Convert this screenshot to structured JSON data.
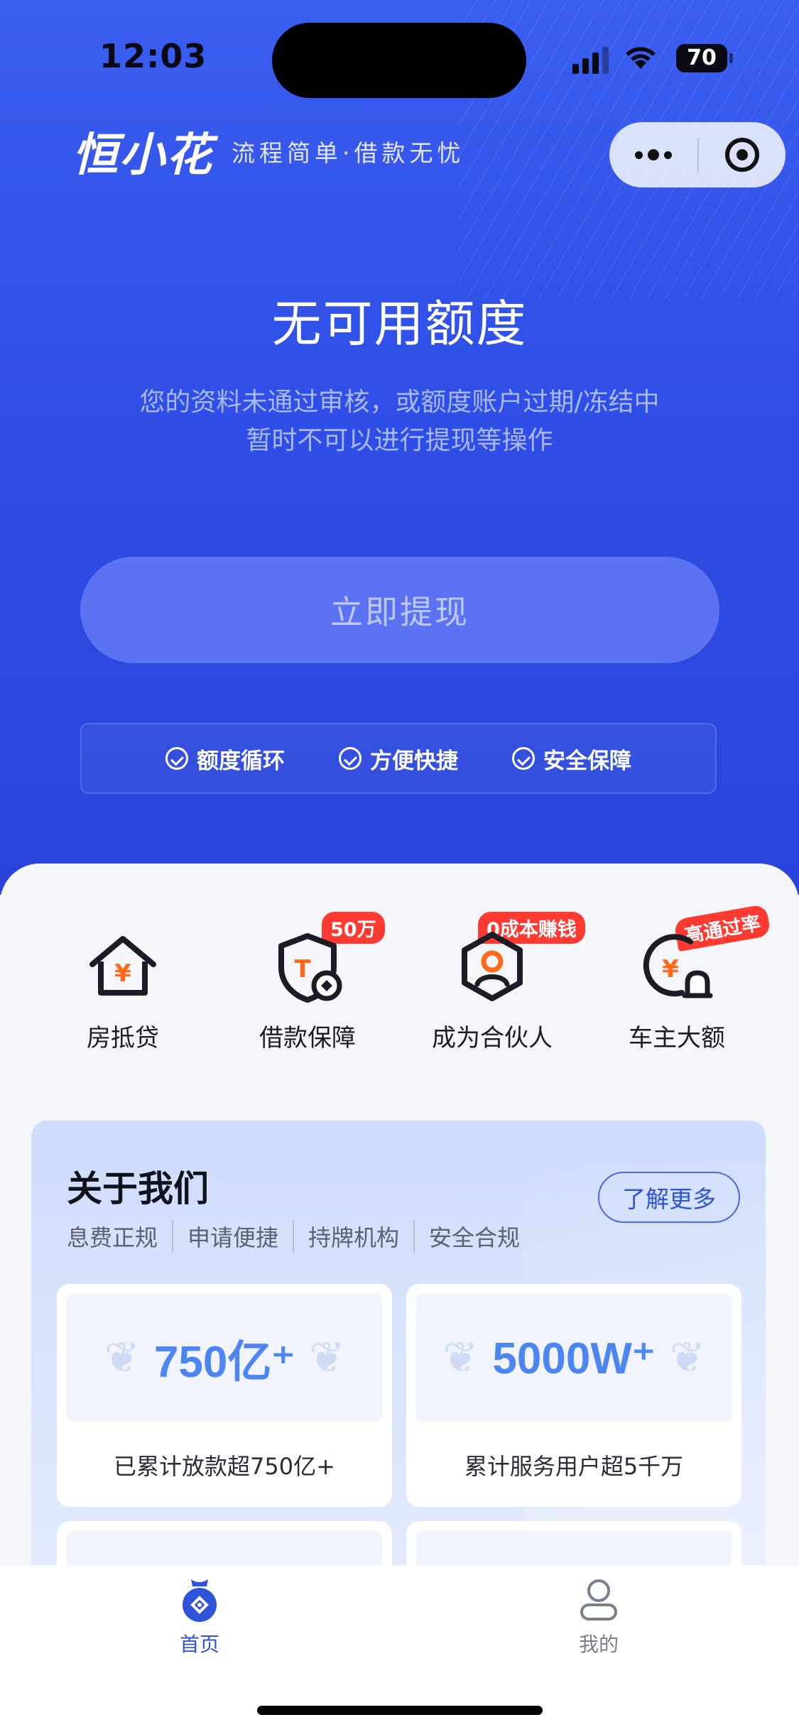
{
  "status_bar": {
    "time": "12:03",
    "battery": "70"
  },
  "brand": {
    "logo": "恒小花",
    "slogan": "流程简单·借款无忧"
  },
  "hero": {
    "title": "无可用额度",
    "desc_line1": "您的资料未通过审核，或额度账户过期/冻结中",
    "desc_line2": "暂时不可以进行提现等操作",
    "withdraw_label": "立即提现",
    "features": [
      "额度循环",
      "方便快捷",
      "安全保障"
    ]
  },
  "services": [
    {
      "label": "房抵贷",
      "icon": "house-yen-icon",
      "badge": ""
    },
    {
      "label": "借款保障",
      "icon": "shield-icon",
      "badge": "50万"
    },
    {
      "label": "成为合伙人",
      "icon": "partner-icon",
      "badge": "0成本赚钱"
    },
    {
      "label": "车主大额",
      "icon": "car-owner-icon",
      "badge": "高通过率"
    }
  ],
  "about": {
    "title": "关于我们",
    "tags": [
      "息费正规",
      "申请便捷",
      "持牌机构",
      "安全合规"
    ],
    "more_label": "了解更多",
    "stats": [
      {
        "value": "750亿⁺",
        "label": "已累计放款超750亿+"
      },
      {
        "value": "5000W⁺",
        "label": "累计服务用户超5千万"
      }
    ]
  },
  "tabbar": {
    "items": [
      {
        "label": "首页",
        "icon": "home-icon",
        "active": true
      },
      {
        "label": "我的",
        "icon": "profile-icon",
        "active": false
      }
    ],
    "active_color": "#2f54d8",
    "inactive_color": "#7a7f8c"
  },
  "colors": {
    "brand_blue": "#2f4fe6",
    "badge_red": "#ff3a30",
    "stat_blue": "#4d86f0"
  }
}
